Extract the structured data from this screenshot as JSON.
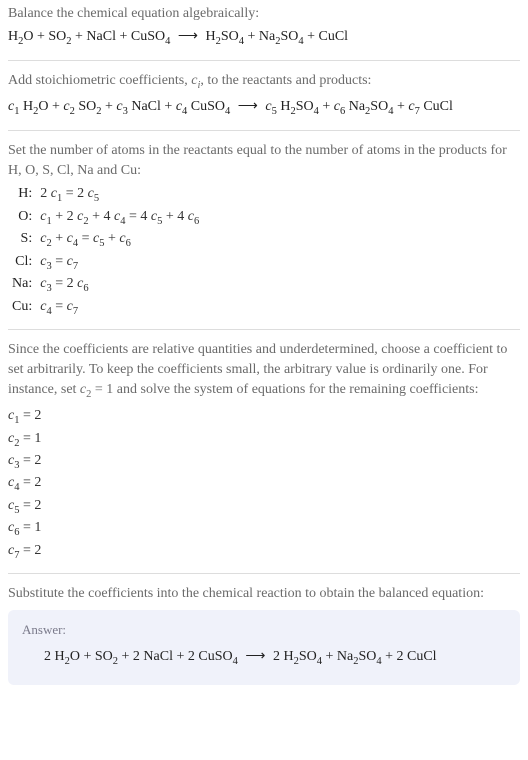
{
  "section1": {
    "intro": "Balance the chemical equation algebraically:"
  },
  "section2": {
    "intro_a": "Add stoichiometric coefficients, ",
    "intro_b": ", to the reactants and products:"
  },
  "section3": {
    "intro": "Set the number of atoms in the reactants equal to the number of atoms in the products for H, O, S, Cl, Na and Cu:",
    "rows": [
      {
        "el": "H:"
      },
      {
        "el": "O:"
      },
      {
        "el": "S:"
      },
      {
        "el": "Cl:"
      },
      {
        "el": "Na:"
      },
      {
        "el": "Cu:"
      }
    ]
  },
  "section4": {
    "intro_a": "Since the coefficients are relative quantities and underdetermined, choose a coefficient to set arbitrarily. To keep the coefficients small, the arbitrary value is ordinarily one. For instance, set ",
    "intro_b": " and solve the system of equations for the remaining coefficients:",
    "coefs": [
      "2",
      "1",
      "2",
      "2",
      "2",
      "1",
      "2"
    ]
  },
  "section5": {
    "intro": "Substitute the coefficients into the chemical reaction to obtain the balanced equation:",
    "answer_label": "Answer:"
  },
  "chart_data": {
    "type": "table",
    "title": "Balancing chemical equation algebraically",
    "reactants": [
      "H2O",
      "SO2",
      "NaCl",
      "CuSO4"
    ],
    "products": [
      "H2SO4",
      "Na2SO4",
      "CuCl"
    ],
    "elements": [
      "H",
      "O",
      "S",
      "Cl",
      "Na",
      "Cu"
    ],
    "element_equations": {
      "H": "2 c1 = 2 c5",
      "O": "c1 + 2 c2 + 4 c4 = 4 c5 + 4 c6",
      "S": "c2 + c4 = c5 + c6",
      "Cl": "c3 = c7",
      "Na": "c3 = 2 c6",
      "Cu": "c4 = c7"
    },
    "fixed_coef": {
      "c2": 1
    },
    "solution": {
      "c1": 2,
      "c2": 1,
      "c3": 2,
      "c4": 2,
      "c5": 2,
      "c6": 1,
      "c7": 2
    },
    "balanced_equation": "2 H2O + SO2 + 2 NaCl + 2 CuSO4 -> 2 H2SO4 + Na2SO4 + 2 CuCl"
  }
}
